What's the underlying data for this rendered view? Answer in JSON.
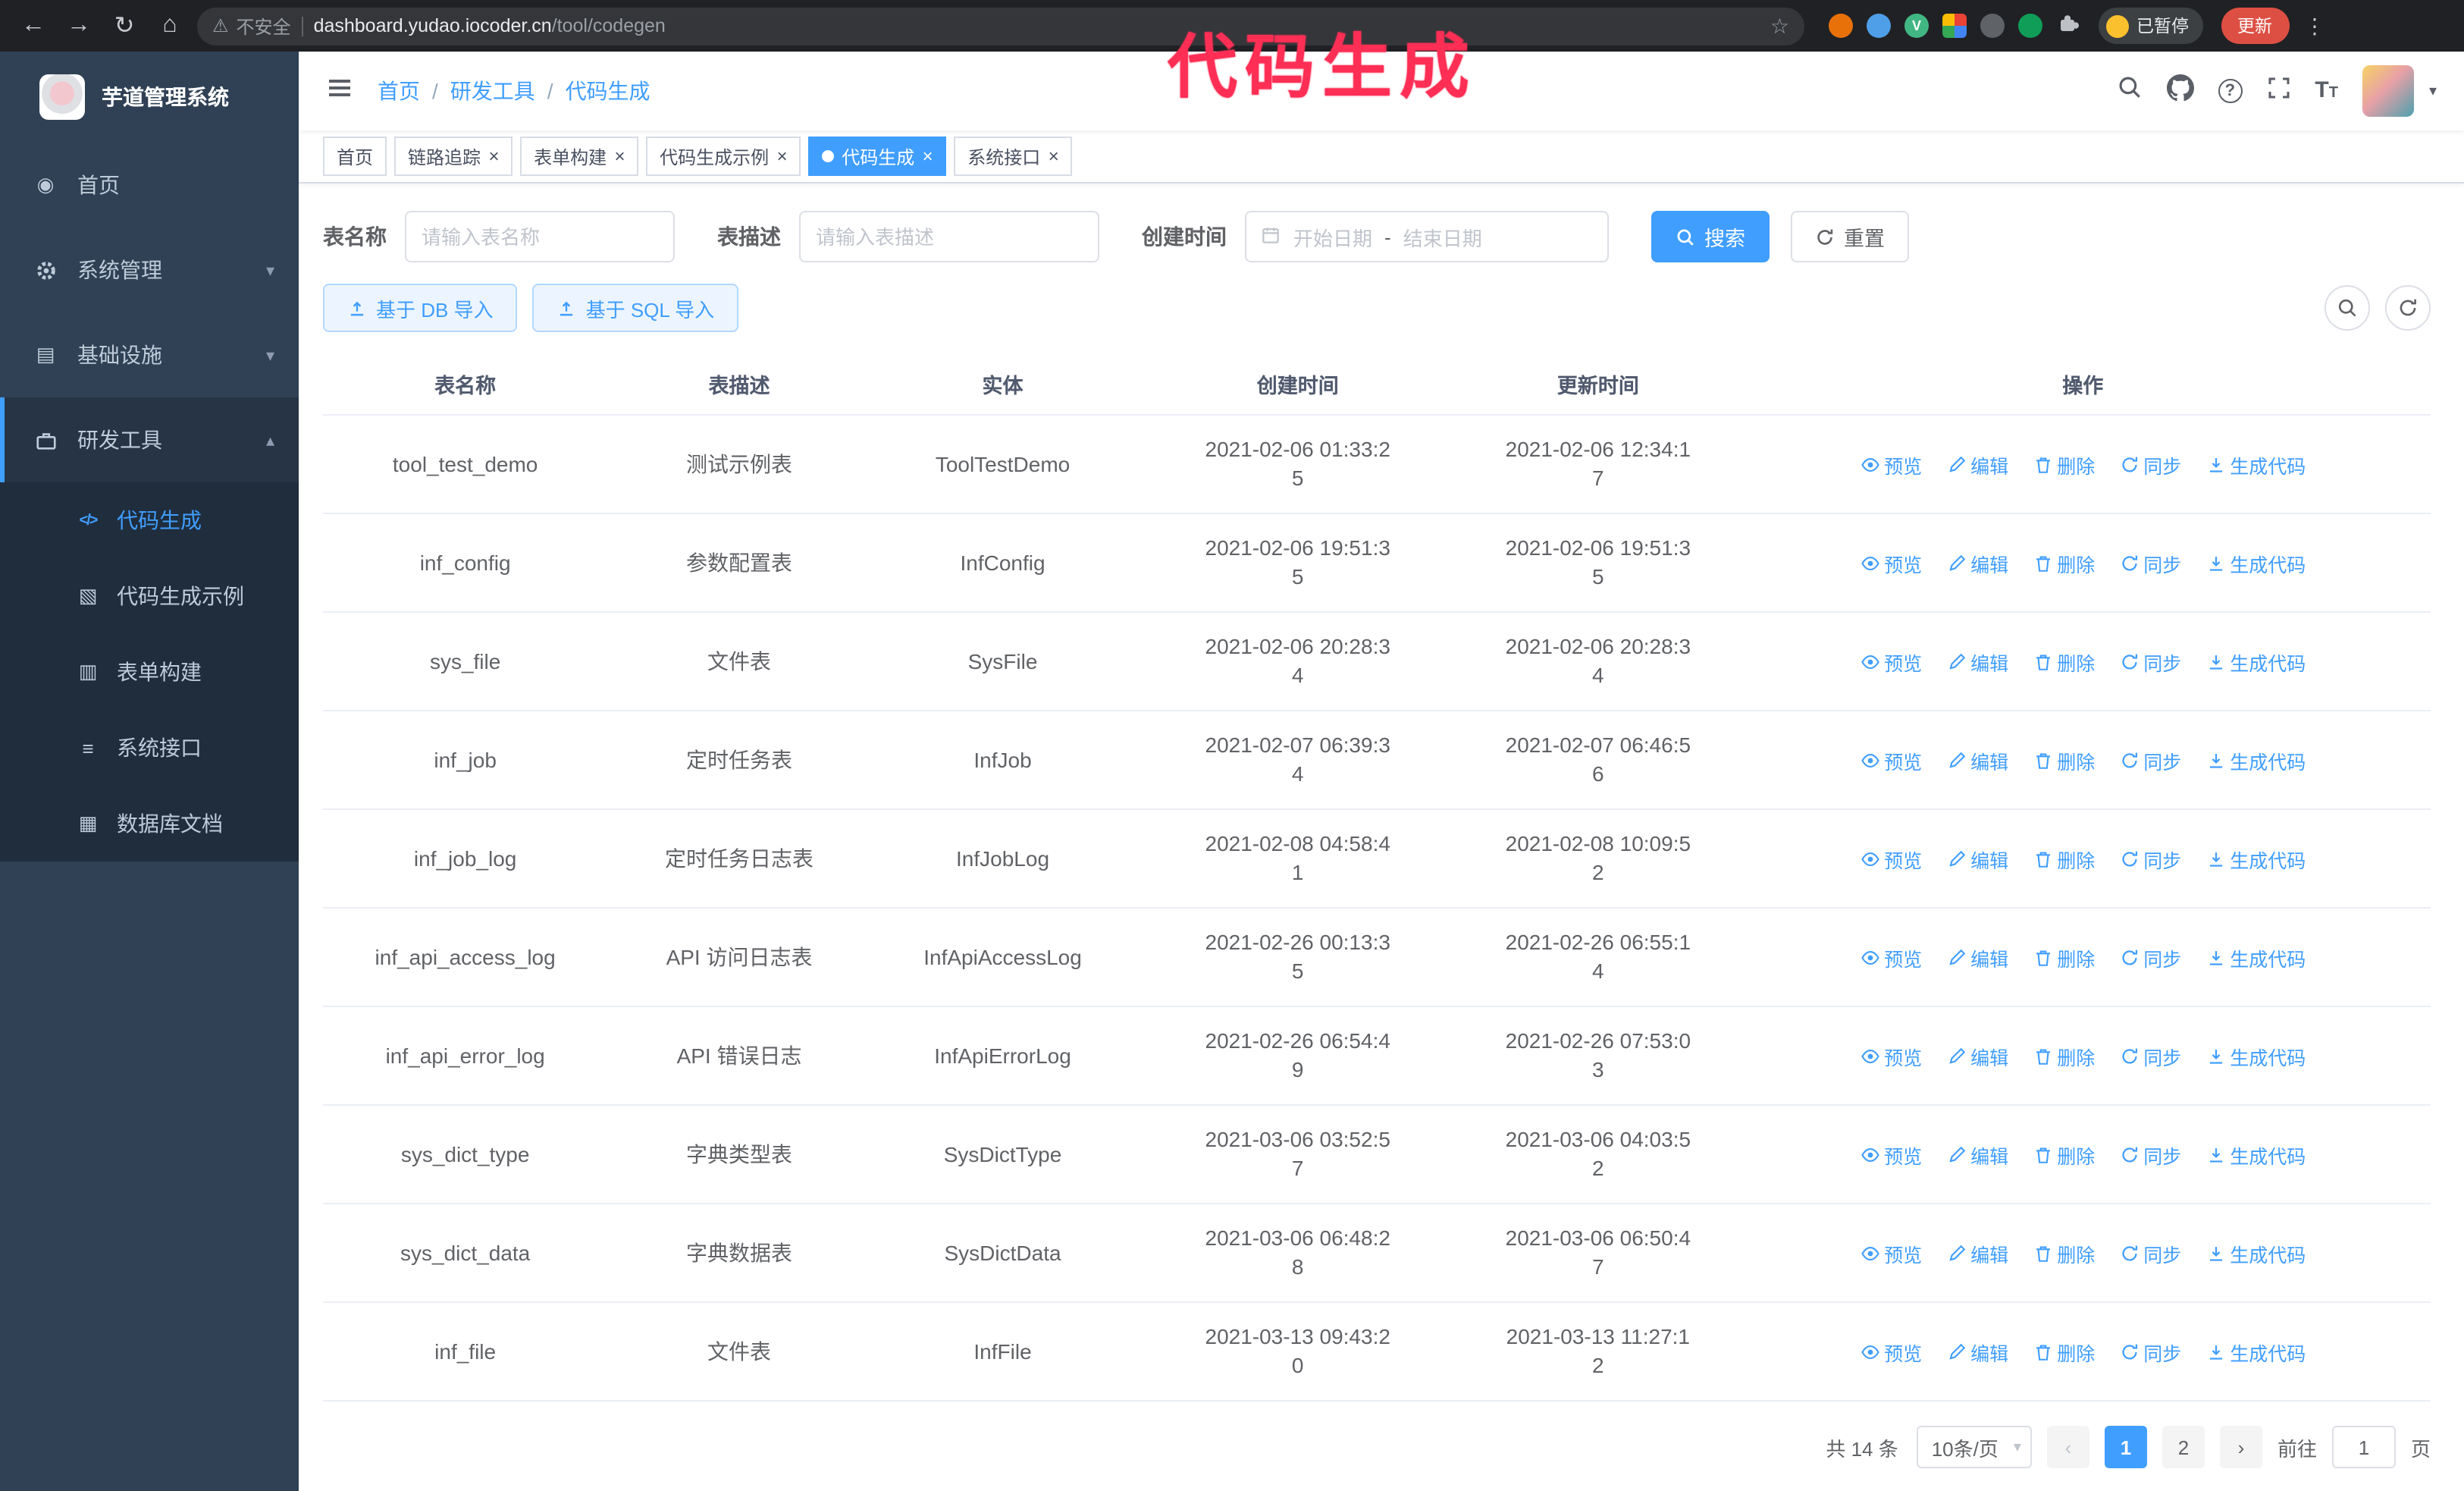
{
  "browser": {
    "security_warning": "不安全",
    "url_host": "dashboard.yudao.iocoder.cn",
    "url_path": "/tool/codegen",
    "paused_badge": "已暂停",
    "update_button": "更新"
  },
  "annotation": "代码生成",
  "sidebar": {
    "title": "芋道管理系统",
    "items": [
      {
        "label": "首页"
      },
      {
        "label": "系统管理"
      },
      {
        "label": "基础设施"
      },
      {
        "label": "研发工具"
      }
    ],
    "subitems": [
      {
        "label": "代码生成",
        "active": true
      },
      {
        "label": "代码生成示例"
      },
      {
        "label": "表单构建"
      },
      {
        "label": "系统接口"
      },
      {
        "label": "数据库文档"
      }
    ]
  },
  "header": {
    "breadcrumb": [
      "首页",
      "研发工具",
      "代码生成"
    ]
  },
  "tabs": [
    {
      "label": "首页",
      "closable": false,
      "active": false
    },
    {
      "label": "链路追踪",
      "closable": true,
      "active": false
    },
    {
      "label": "表单构建",
      "closable": true,
      "active": false
    },
    {
      "label": "代码生成示例",
      "closable": true,
      "active": false
    },
    {
      "label": "代码生成",
      "closable": true,
      "active": true
    },
    {
      "label": "系统接口",
      "closable": true,
      "active": false
    }
  ],
  "filters": {
    "table_name_label": "表名称",
    "table_name_placeholder": "请输入表名称",
    "table_desc_label": "表描述",
    "table_desc_placeholder": "请输入表描述",
    "create_time_label": "创建时间",
    "date_start_placeholder": "开始日期",
    "date_separator": "-",
    "date_end_placeholder": "结束日期",
    "search_button": "搜索",
    "reset_button": "重置"
  },
  "toolbar": {
    "import_db_button": "基于 DB 导入",
    "import_sql_button": "基于 SQL 导入"
  },
  "table": {
    "columns": [
      "表名称",
      "表描述",
      "实体",
      "创建时间",
      "更新时间",
      "操作"
    ],
    "actions": [
      "预览",
      "编辑",
      "删除",
      "同步",
      "生成代码"
    ],
    "rows": [
      {
        "name": "tool_test_demo",
        "desc": "测试示例表",
        "entity": "ToolTestDemo",
        "created": "2021-02-06 01:33:25",
        "updated": "2021-02-06 12:34:17"
      },
      {
        "name": "inf_config",
        "desc": "参数配置表",
        "entity": "InfConfig",
        "created": "2021-02-06 19:51:35",
        "updated": "2021-02-06 19:51:35"
      },
      {
        "name": "sys_file",
        "desc": "文件表",
        "entity": "SysFile",
        "created": "2021-02-06 20:28:34",
        "updated": "2021-02-06 20:28:34"
      },
      {
        "name": "inf_job",
        "desc": "定时任务表",
        "entity": "InfJob",
        "created": "2021-02-07 06:39:34",
        "updated": "2021-02-07 06:46:56"
      },
      {
        "name": "inf_job_log",
        "desc": "定时任务日志表",
        "entity": "InfJobLog",
        "created": "2021-02-08 04:58:41",
        "updated": "2021-02-08 10:09:52"
      },
      {
        "name": "inf_api_access_log",
        "desc": "API 访问日志表",
        "entity": "InfApiAccessLog",
        "created": "2021-02-26 00:13:35",
        "updated": "2021-02-26 06:55:14"
      },
      {
        "name": "inf_api_error_log",
        "desc": "API 错误日志",
        "entity": "InfApiErrorLog",
        "created": "2021-02-26 06:54:49",
        "updated": "2021-02-26 07:53:03"
      },
      {
        "name": "sys_dict_type",
        "desc": "字典类型表",
        "entity": "SysDictType",
        "created": "2021-03-06 03:52:57",
        "updated": "2021-03-06 04:03:52"
      },
      {
        "name": "sys_dict_data",
        "desc": "字典数据表",
        "entity": "SysDictData",
        "created": "2021-03-06 06:48:28",
        "updated": "2021-03-06 06:50:47"
      },
      {
        "name": "inf_file",
        "desc": "文件表",
        "entity": "InfFile",
        "created": "2021-03-13 09:43:20",
        "updated": "2021-03-13 11:27:12"
      }
    ]
  },
  "pagination": {
    "total": "共 14 条",
    "page_size": "10条/页",
    "pages": [
      {
        "label": "1",
        "active": true
      },
      {
        "label": "2",
        "active": false
      }
    ],
    "goto_label": "前往",
    "goto_value": "1",
    "page_suffix": "页"
  }
}
